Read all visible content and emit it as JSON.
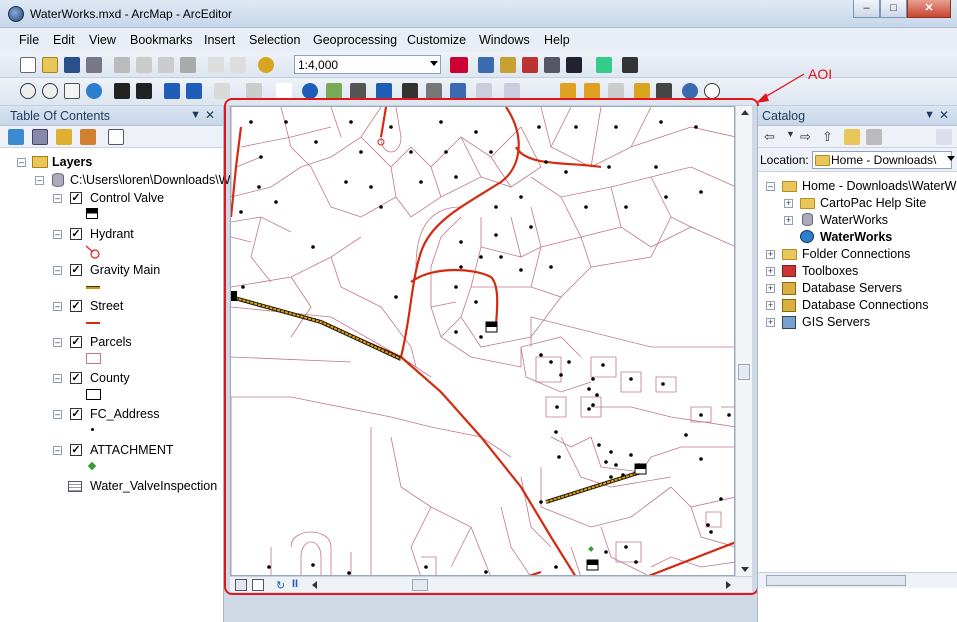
{
  "window": {
    "title": "WaterWorks.mxd - ArcMap - ArcEditor"
  },
  "menu": [
    "File",
    "Edit",
    "View",
    "Bookmarks",
    "Insert",
    "Selection",
    "Geoprocessing",
    "Customize",
    "Windows",
    "Help"
  ],
  "scale": "1:4,000",
  "toc": {
    "title": "Table Of Contents",
    "root": "Layers",
    "source": "C:\\Users\\loren\\Downloads\\W",
    "layers": [
      {
        "name": "Control Valve",
        "checked": true
      },
      {
        "name": "Hydrant",
        "checked": true
      },
      {
        "name": "Gravity Main",
        "checked": true
      },
      {
        "name": "Street",
        "checked": true
      },
      {
        "name": "Parcels",
        "checked": true
      },
      {
        "name": "County",
        "checked": true
      },
      {
        "name": "FC_Address",
        "checked": true
      },
      {
        "name": "ATTACHMENT",
        "checked": true
      }
    ],
    "table": "Water_ValveInspection"
  },
  "annotation": {
    "label": "AOI",
    "color": "#e0161d"
  },
  "catalog": {
    "title": "Catalog",
    "location_label": "Location:",
    "location_value": "Home - Downloads\\",
    "items": [
      {
        "label": "Home - Downloads\\WaterW",
        "bold": false
      },
      {
        "label": "CartoPac Help Site",
        "bold": false
      },
      {
        "label": "WaterWorks",
        "bold": false
      },
      {
        "label": "WaterWorks",
        "bold": true
      },
      {
        "label": "Folder Connections",
        "bold": false
      },
      {
        "label": "Toolboxes",
        "bold": false
      },
      {
        "label": "Database Servers",
        "bold": false
      },
      {
        "label": "Database Connections",
        "bold": false
      },
      {
        "label": "GIS Servers",
        "bold": false
      }
    ]
  },
  "colors": {
    "street": "#d42a10",
    "parcel": "#c0788a",
    "gravity_main": "#e8a000"
  }
}
